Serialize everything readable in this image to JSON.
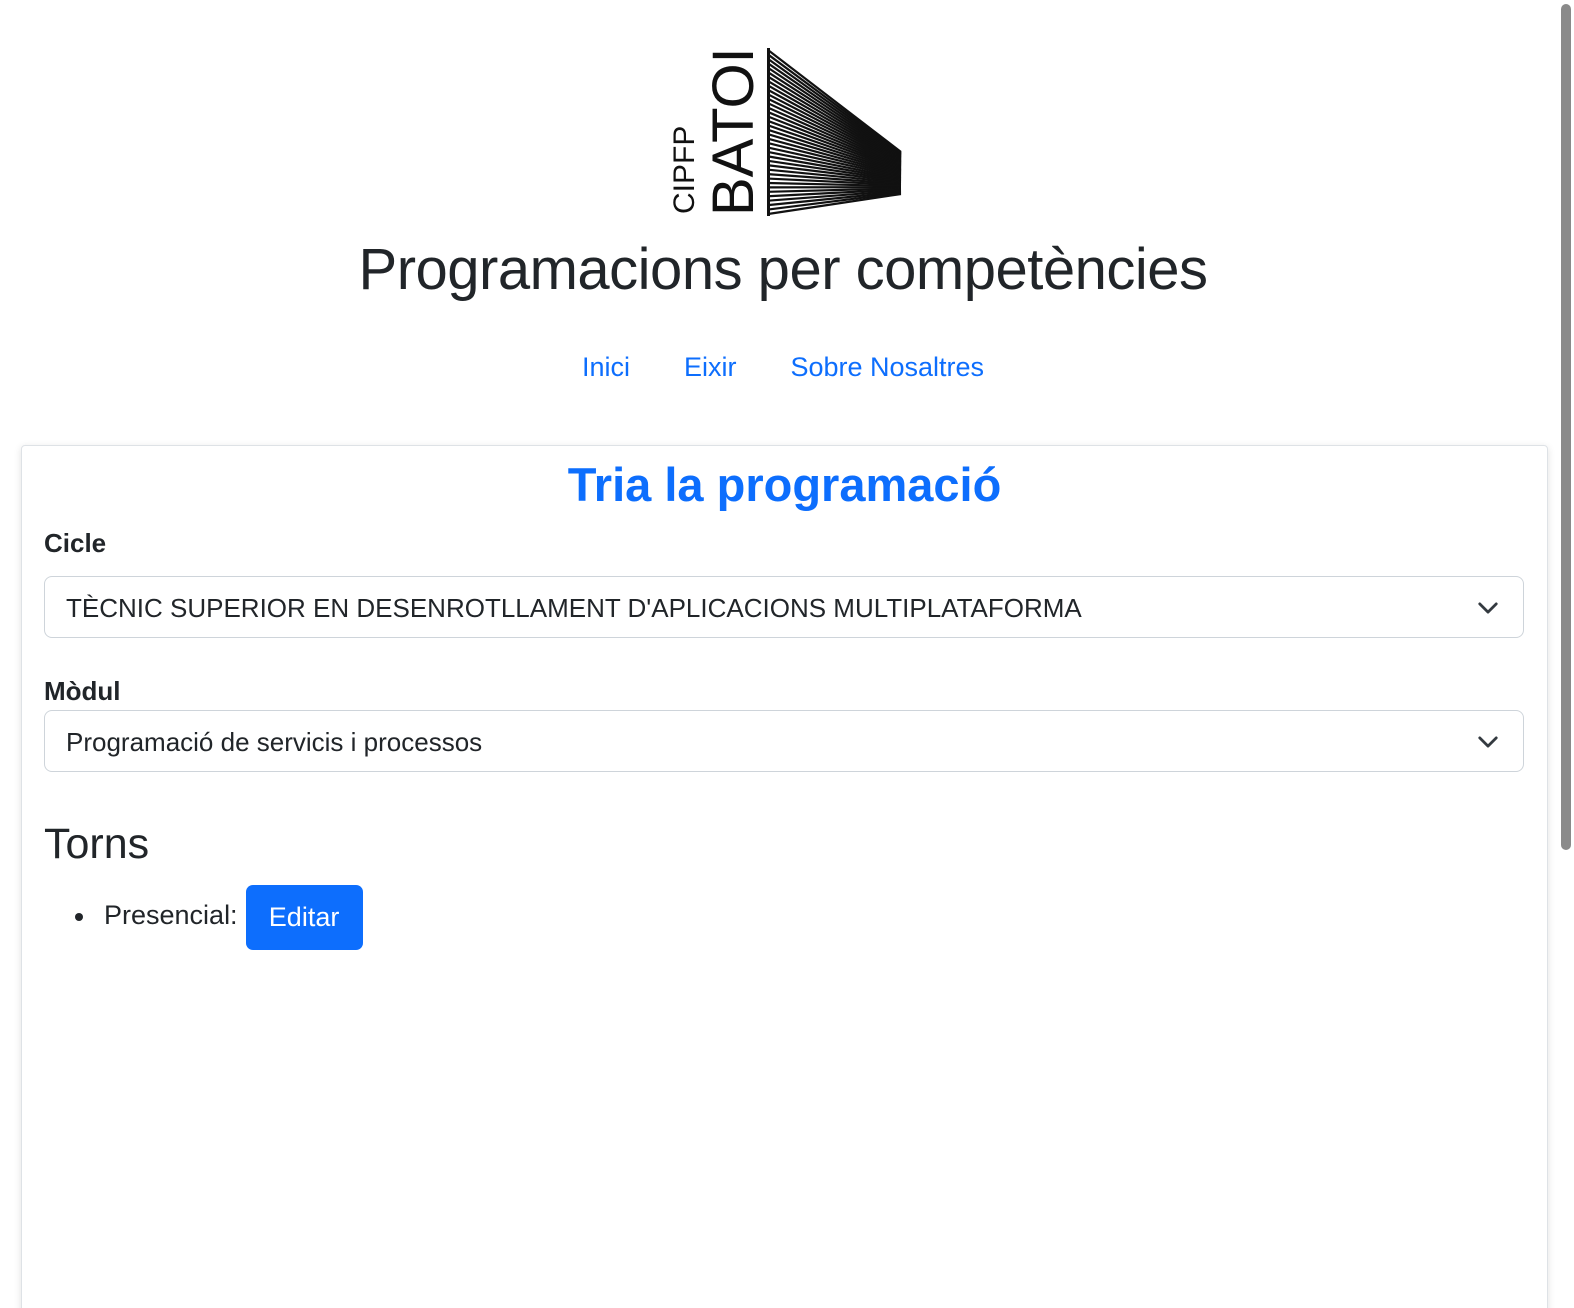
{
  "header": {
    "logo": {
      "line1": "CIPFP",
      "line2": "BATOI",
      "icon": "batoi-logo-stripes"
    },
    "title": "Programacions per competències"
  },
  "nav": {
    "items": [
      {
        "label": "Inici"
      },
      {
        "label": "Eixir"
      },
      {
        "label": "Sobre Nosaltres"
      }
    ]
  },
  "main": {
    "title": "Tria la programació",
    "cicle": {
      "label": "Cicle",
      "selected": "TÈCNIC SUPERIOR EN DESENROTLLAMENT D'APLICACIONS MULTIPLATAFORMA"
    },
    "modul": {
      "label": "Mòdul",
      "selected": "Programació de servicis i processos"
    },
    "torns": {
      "heading": "Torns",
      "items": [
        {
          "label": "Presencial:",
          "button": "Editar"
        }
      ]
    }
  },
  "colors": {
    "primary": "#0d6efd",
    "text": "#212529",
    "border": "#ced4da"
  }
}
